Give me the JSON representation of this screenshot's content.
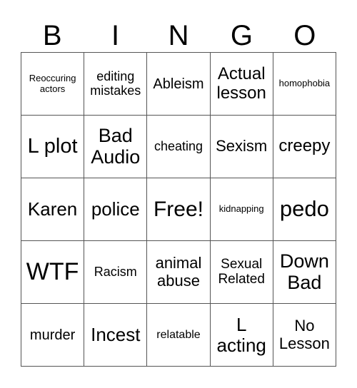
{
  "header": [
    "B",
    "I",
    "N",
    "G",
    "O"
  ],
  "cells": [
    {
      "text": "Reoccuring actors",
      "size": 13
    },
    {
      "text": "editing mistakes",
      "size": 18
    },
    {
      "text": "Ableism",
      "size": 20
    },
    {
      "text": "Actual lesson",
      "size": 24
    },
    {
      "text": "homophobia",
      "size": 13
    },
    {
      "text": "L plot",
      "size": 29
    },
    {
      "text": "Bad Audio",
      "size": 27
    },
    {
      "text": "cheating",
      "size": 18
    },
    {
      "text": "Sexism",
      "size": 22
    },
    {
      "text": "creepy",
      "size": 24
    },
    {
      "text": "Karen",
      "size": 26
    },
    {
      "text": "police",
      "size": 26
    },
    {
      "text": "Free!",
      "size": 30
    },
    {
      "text": "kidnapping",
      "size": 13
    },
    {
      "text": "pedo",
      "size": 31
    },
    {
      "text": "WTF",
      "size": 34
    },
    {
      "text": "Racism",
      "size": 18
    },
    {
      "text": "animal abuse",
      "size": 22
    },
    {
      "text": "Sexual Related",
      "size": 19
    },
    {
      "text": "Down Bad",
      "size": 27
    },
    {
      "text": "murder",
      "size": 20
    },
    {
      "text": "Incest",
      "size": 26
    },
    {
      "text": "relatable",
      "size": 16
    },
    {
      "text": "L acting",
      "size": 26
    },
    {
      "text": "No Lesson",
      "size": 22
    }
  ]
}
